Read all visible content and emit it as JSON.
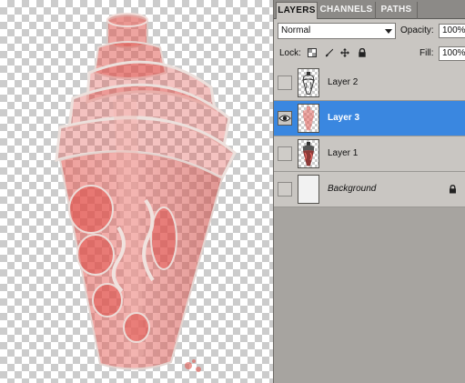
{
  "panel": {
    "tabs": [
      {
        "label": "LAYERS",
        "active": true
      },
      {
        "label": "CHANNELS",
        "active": false
      },
      {
        "label": "PATHS",
        "active": false
      }
    ],
    "blend_mode": "Normal",
    "opacity_label": "Opacity:",
    "opacity_value": "100%",
    "lock_label": "Lock:",
    "fill_label": "Fill:",
    "fill_value": "100%",
    "lock_icons": [
      "lock-transparent-icon",
      "lock-image-brush-icon",
      "lock-position-move-icon",
      "lock-all-padlock-icon"
    ]
  },
  "layers": [
    {
      "name": "Layer 2",
      "visible": false,
      "selected": false
    },
    {
      "name": "Layer 3",
      "visible": true,
      "selected": true
    },
    {
      "name": "Layer 1",
      "visible": false,
      "selected": false
    },
    {
      "name": "Background",
      "visible": false,
      "selected": false,
      "locked": true
    }
  ],
  "colors": {
    "selection": "#3a87e0",
    "artwork": "#e0504a",
    "panel_bg": "#c9c6c2"
  }
}
